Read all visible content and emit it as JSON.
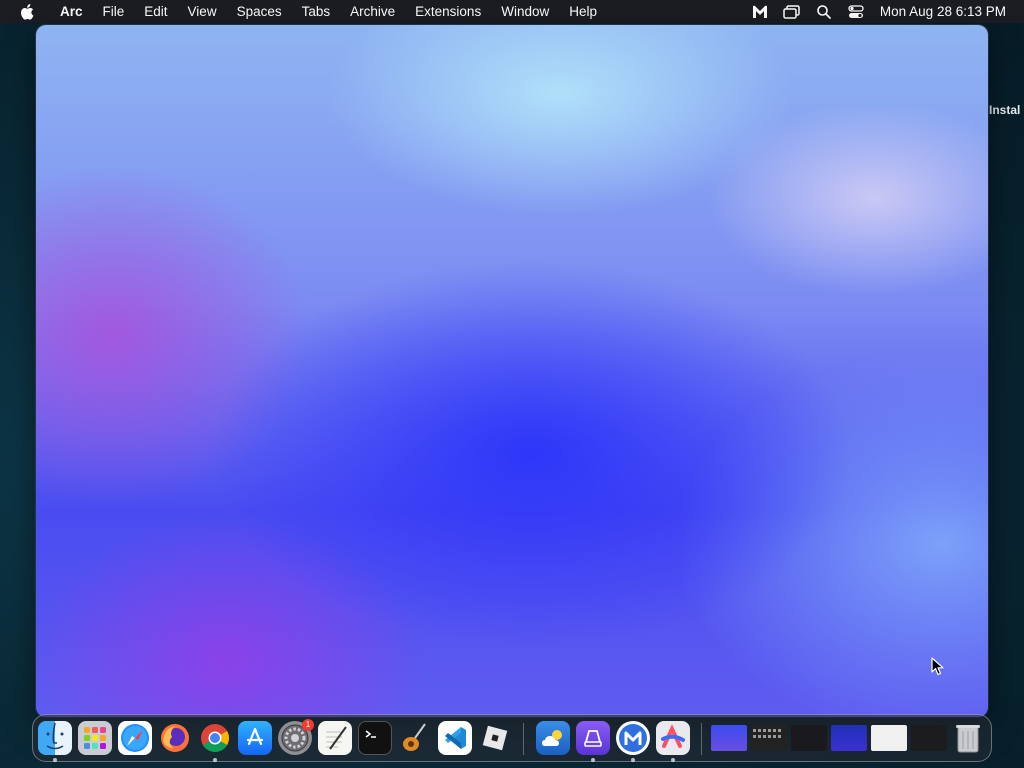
{
  "menubar": {
    "app_name": "Arc",
    "menus": [
      "File",
      "Edit",
      "View",
      "Spaces",
      "Tabs",
      "Archive",
      "Extensions",
      "Window",
      "Help"
    ],
    "status_icons": [
      "malwarebytes-icon",
      "screen-mirroring-icon",
      "spotlight-search-icon",
      "control-center-icon"
    ],
    "clock": "Mon Aug 28  6:13 PM"
  },
  "desktop": {
    "peek_label": "Instal"
  },
  "dock": {
    "apps": [
      {
        "name": "Finder",
        "icon": "finder-icon",
        "running": true
      },
      {
        "name": "Launchpad",
        "icon": "launchpad-icon",
        "running": false
      },
      {
        "name": "Safari",
        "icon": "safari-icon",
        "running": false
      },
      {
        "name": "Firefox",
        "icon": "firefox-icon",
        "running": false
      },
      {
        "name": "Google Chrome",
        "icon": "chrome-icon",
        "running": true
      },
      {
        "name": "App Store",
        "icon": "app-store-icon",
        "running": false
      },
      {
        "name": "System Settings",
        "icon": "system-settings-icon",
        "running": false,
        "badge": "1"
      },
      {
        "name": "TextEdit",
        "icon": "textedit-icon",
        "running": false
      },
      {
        "name": "Terminal",
        "icon": "terminal-icon",
        "running": false
      },
      {
        "name": "GarageBand",
        "icon": "garageband-icon",
        "running": false
      },
      {
        "name": "Visual Studio Code",
        "icon": "vscode-icon",
        "running": false
      },
      {
        "name": "Roblox",
        "icon": "roblox-icon",
        "running": false
      }
    ],
    "recent_apps": [
      {
        "name": "Weather",
        "icon": "weather-icon",
        "running": false
      },
      {
        "name": "Arc",
        "icon": "arc-icon",
        "running": true
      },
      {
        "name": "Malwarebytes",
        "icon": "malwarebytes-icon",
        "running": true
      },
      {
        "name": "Arc Browser",
        "icon": "arc-browser-icon",
        "running": true
      }
    ],
    "minimized": [
      {
        "name": "Minimized window 1",
        "icon": "minimized-window-icon"
      },
      {
        "name": "Minimized window 2",
        "icon": "minimized-window-icon"
      },
      {
        "name": "Minimized window 3",
        "icon": "minimized-window-icon"
      },
      {
        "name": "Minimized window 4",
        "icon": "minimized-window-icon"
      },
      {
        "name": "Minimized window 5",
        "icon": "minimized-window-icon"
      },
      {
        "name": "Minimized window 6",
        "icon": "minimized-window-icon"
      }
    ],
    "trash": {
      "name": "Trash",
      "icon": "trash-icon"
    }
  }
}
